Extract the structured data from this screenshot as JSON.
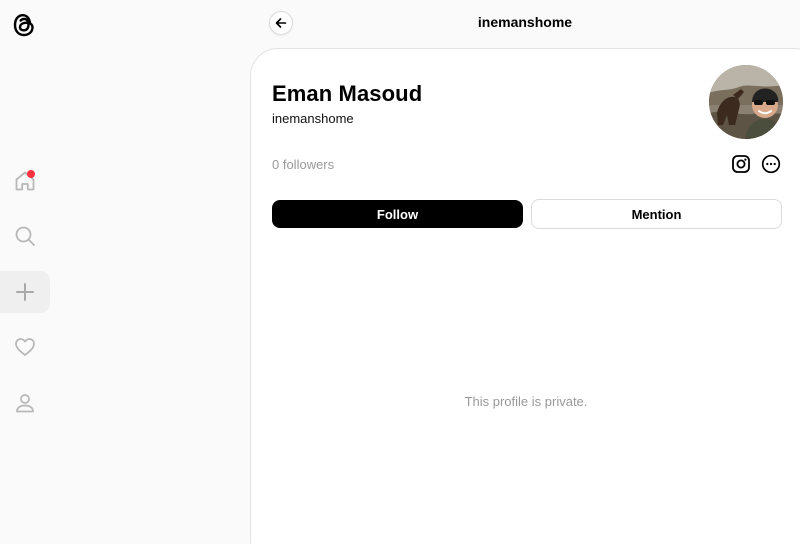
{
  "header": {
    "title": "inemanshome",
    "back_icon": "arrow-left-icon"
  },
  "sidebar": {
    "logo_icon": "threads-logo-icon",
    "items": [
      {
        "icon": "home-icon",
        "notification_color": "#ff3040"
      },
      {
        "icon": "search-icon"
      },
      {
        "icon": "plus-icon",
        "active": true
      },
      {
        "icon": "heart-icon"
      },
      {
        "icon": "person-icon"
      }
    ]
  },
  "profile": {
    "display_name": "Eman Masoud",
    "handle": "inemanshome",
    "followers": "0 followers",
    "follow_label": "Follow",
    "mention_label": "Mention",
    "private_message": "This profile is private."
  },
  "colors": {
    "page_bg": "#fafafa",
    "card_bg": "#ffffff",
    "muted_text": "#999999",
    "primary_button": "#000000"
  }
}
